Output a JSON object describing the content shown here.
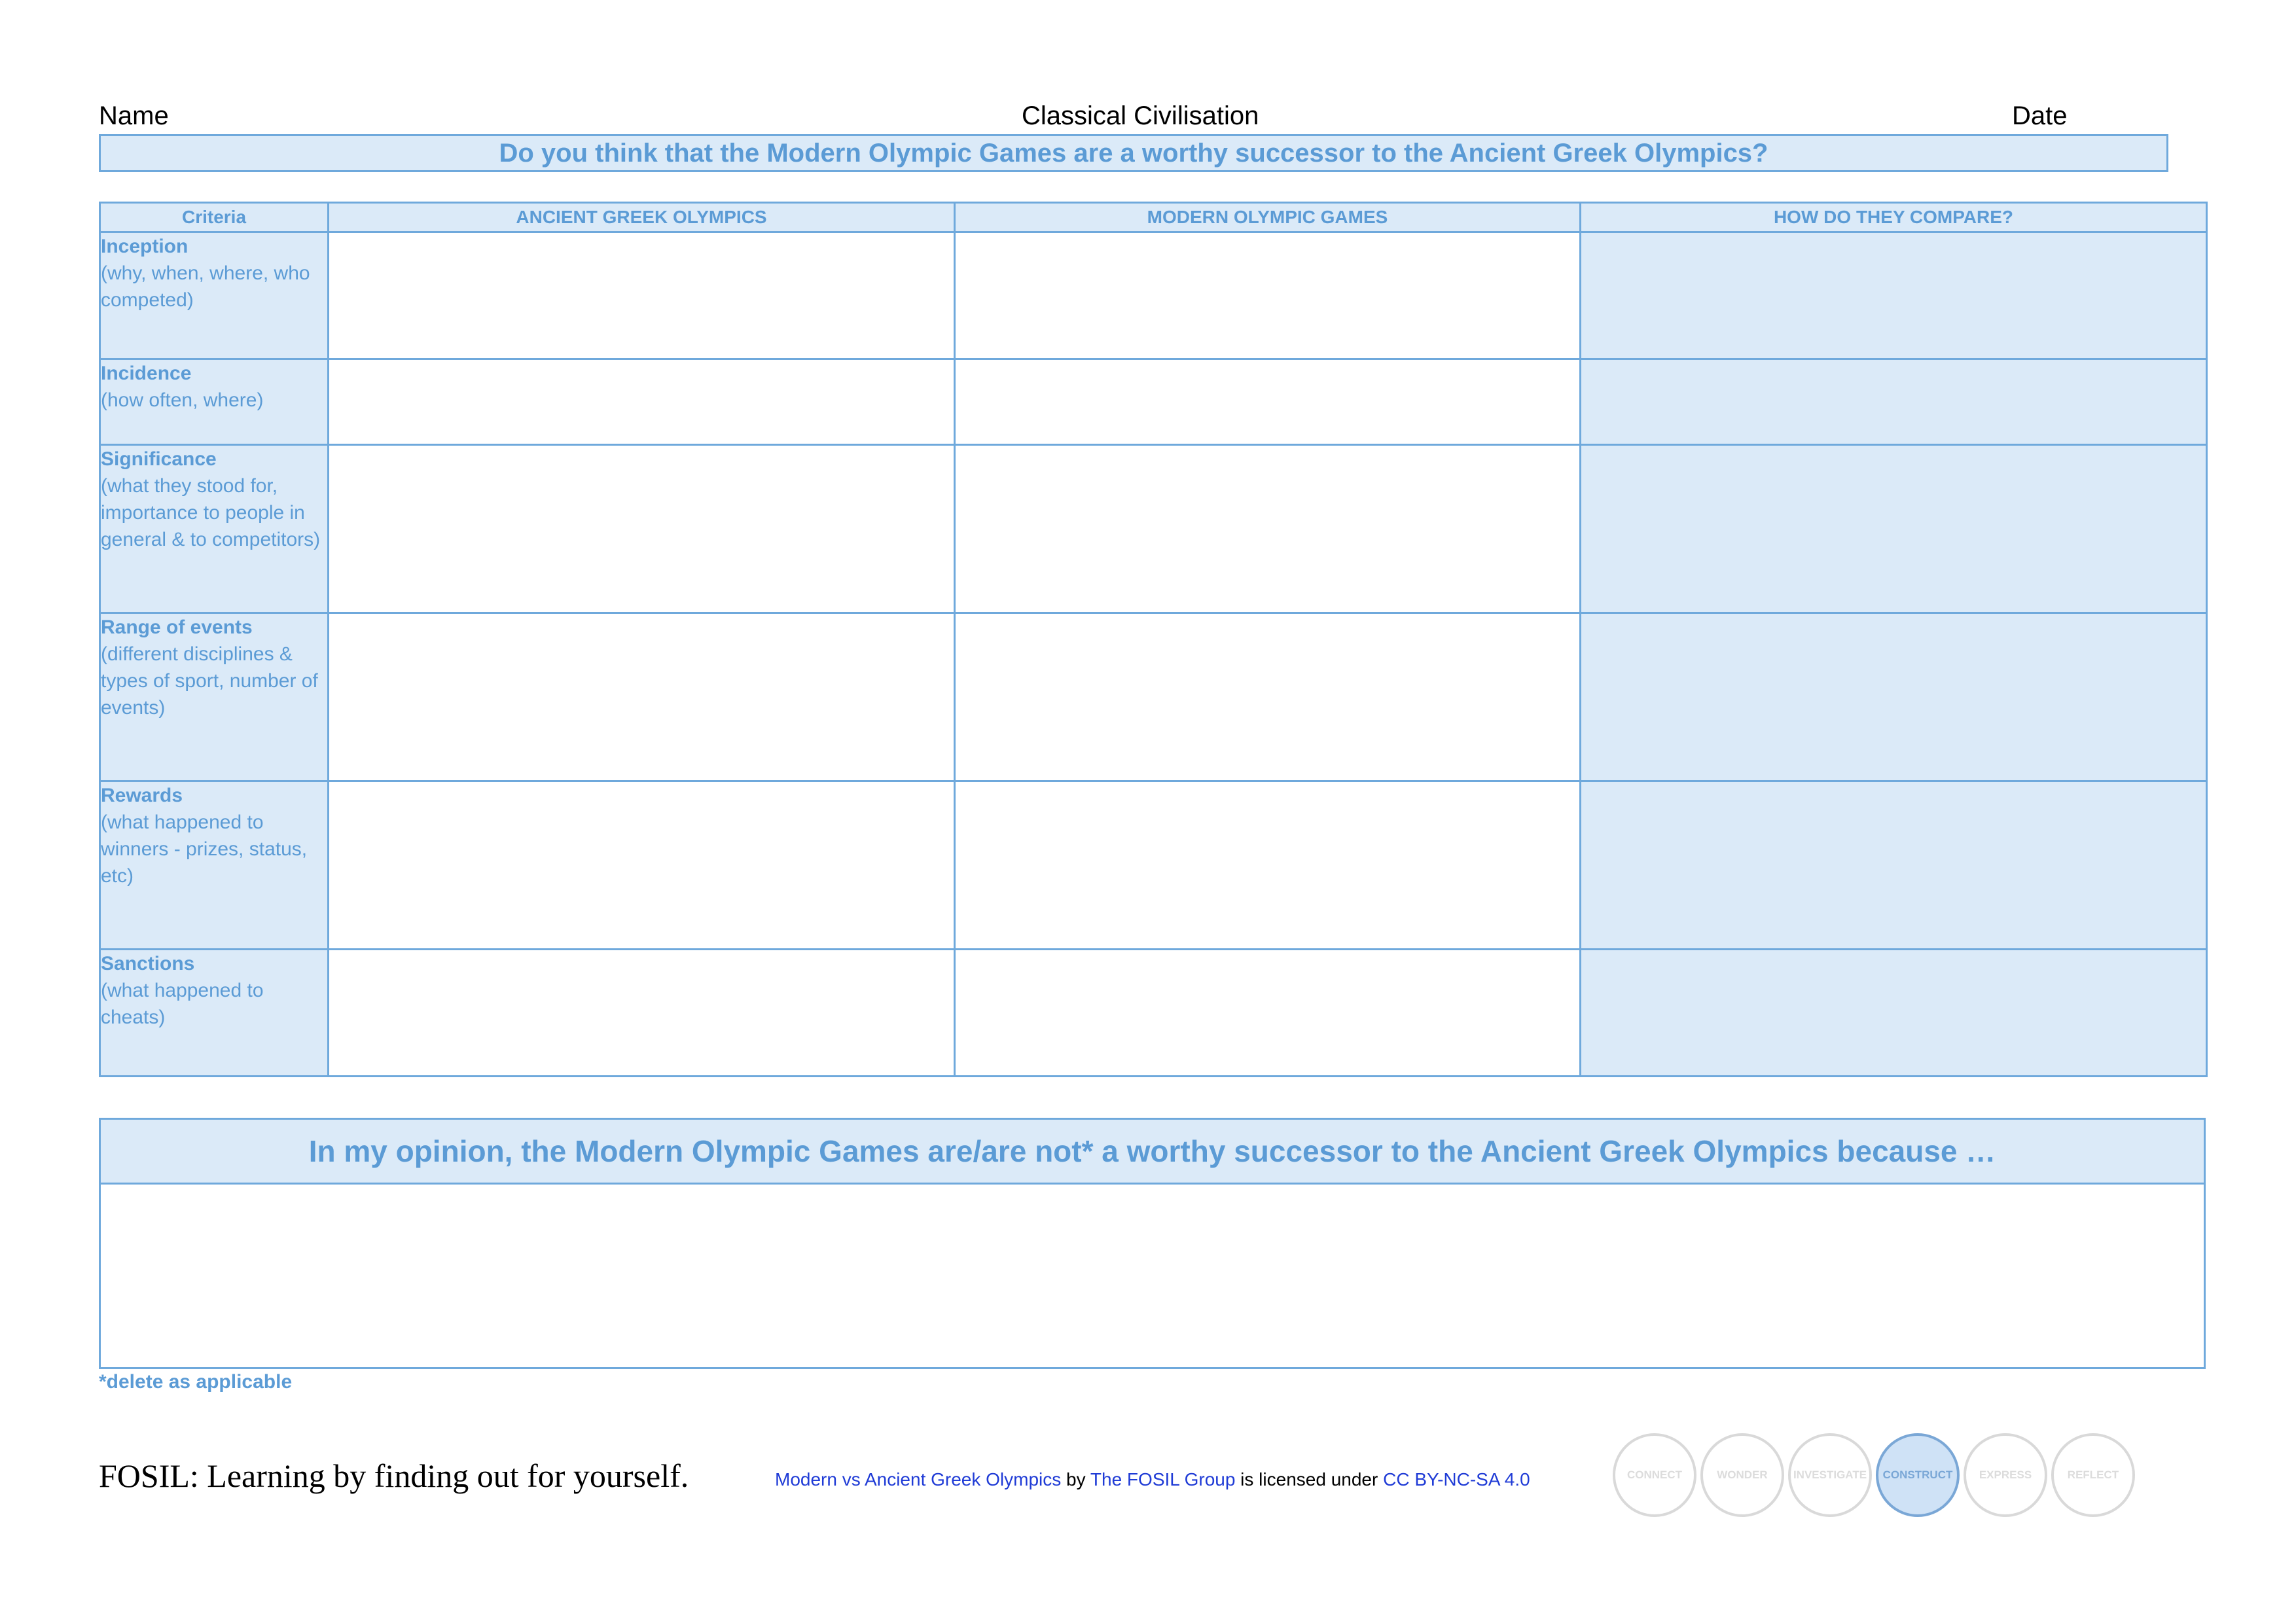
{
  "header": {
    "name_label": "Name",
    "subject": "Classical Civilisation",
    "date_label": "Date"
  },
  "question": "Do you think that the Modern Olympic Games are a worthy successor to the Ancient Greek Olympics?",
  "table": {
    "columns": [
      "Criteria",
      "ANCIENT GREEK OLYMPICS",
      "MODERN OLYMPIC GAMES",
      "HOW DO THEY COMPARE?"
    ],
    "rows": [
      {
        "title": "Inception",
        "detail": "(why, when, where, who competed)"
      },
      {
        "title": "Incidence",
        "detail": "(how often, where)"
      },
      {
        "title": "Significance",
        "detail": "(what they stood for, importance to people in general & to competitors)"
      },
      {
        "title": "Range of events",
        "detail": "(different disciplines & types of sport, number of events)"
      },
      {
        "title": "Rewards",
        "detail": "(what happened to winners - prizes, status, etc)"
      },
      {
        "title": "Sanctions",
        "detail": "(what happened to cheats)"
      }
    ]
  },
  "opinion_heading": "In my opinion, the Modern Olympic Games are/are not* a worthy successor to the Ancient Greek Olympics because …",
  "note": "*delete as applicable",
  "footer": {
    "tagline": "FOSIL: Learning by finding out for yourself.",
    "license": {
      "work": "Modern vs Ancient Greek Olympics",
      "by": " by ",
      "author": "The FOSIL Group",
      "licensed": " is licensed under ",
      "license_name": "CC BY-NC-SA 4.0"
    },
    "stages": [
      "CONNECT",
      "WONDER",
      "INVESTIGATE",
      "CONSTRUCT",
      "EXPRESS",
      "REFLECT"
    ],
    "active_stage": "CONSTRUCT"
  },
  "colors": {
    "accent": "#5b9bd5",
    "border": "#6fa9dc",
    "fill": "#dbeaf8",
    "link": "#1f3bd6"
  }
}
